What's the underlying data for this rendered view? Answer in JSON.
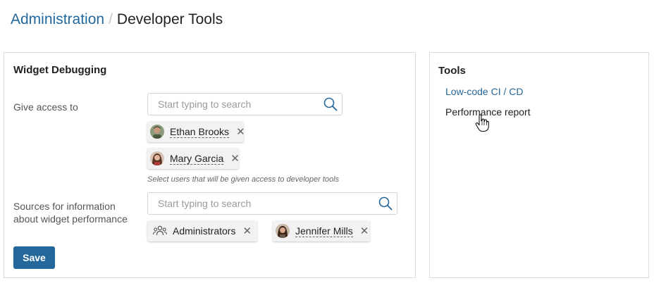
{
  "breadcrumb": {
    "parent": "Administration",
    "separator": "/",
    "current": "Developer Tools"
  },
  "widget_debugging": {
    "title": "Widget Debugging",
    "give_access": {
      "label": "Give access to",
      "placeholder": "Start typing to search",
      "selected": [
        {
          "name": "Ethan Brooks"
        },
        {
          "name": "Mary Garcia"
        }
      ],
      "hint": "Select users that will be given access to developer tools"
    },
    "sources": {
      "label_line1": "Sources for information",
      "label_line2": "about widget performance",
      "placeholder": "Start typing to search",
      "selected": [
        {
          "name": "Administrators",
          "type": "group"
        },
        {
          "name": "Jennifer Mills",
          "type": "user"
        }
      ]
    },
    "save_label": "Save"
  },
  "tools": {
    "title": "Tools",
    "items": [
      {
        "label": "Low-code CI / CD"
      },
      {
        "label": "Performance report"
      }
    ]
  },
  "colors": {
    "accent": "#24679b",
    "chip_bg": "#f2f2f2",
    "border": "#dcdcdc"
  },
  "icons": [
    "search-icon",
    "close-icon",
    "group-icon",
    "avatar",
    "hand-cursor-icon"
  ]
}
